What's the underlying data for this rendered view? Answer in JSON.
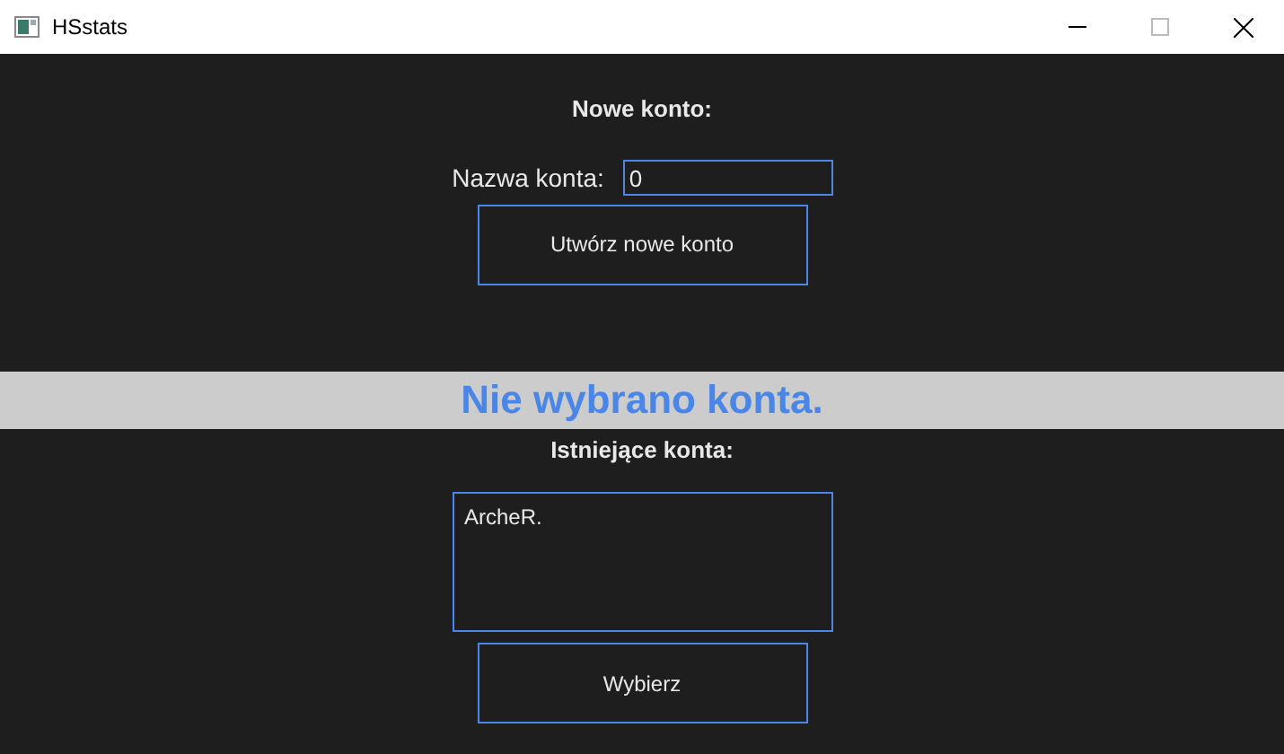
{
  "window": {
    "title": "HSstats"
  },
  "new_account": {
    "heading": "Nowe konto:",
    "name_label": "Nazwa konta:",
    "name_value": "0",
    "create_button": "Utwórz nowe konto"
  },
  "banner": {
    "text": "Nie wybrano konta."
  },
  "existing_accounts": {
    "heading": "Istniejące konta:",
    "items": [
      {
        "name": "ArcheR."
      }
    ],
    "select_button": "Wybierz"
  }
}
